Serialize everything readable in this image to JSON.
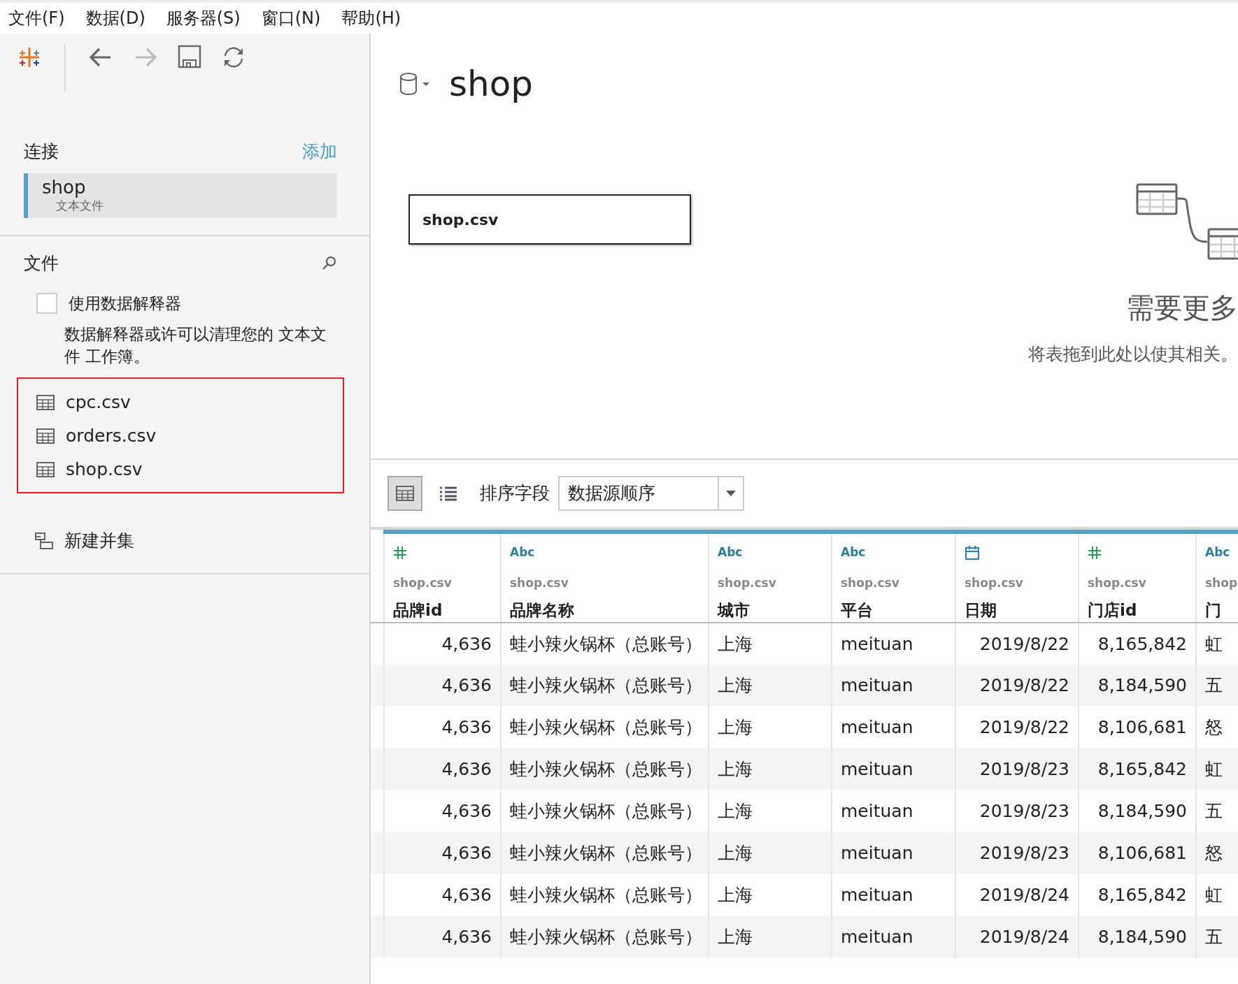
{
  "menu": [
    "文件(F)",
    "数据(D)",
    "服务器(S)",
    "窗口(N)",
    "帮助(H)"
  ],
  "toolbar": [
    {
      "kind": "logo",
      "disabled": false
    },
    {
      "kind": "back",
      "disabled": false
    },
    {
      "kind": "forward",
      "disabled": true
    },
    {
      "kind": "save",
      "disabled": false
    },
    {
      "kind": "refresh",
      "disabled": false
    }
  ],
  "connections": {
    "title": "连接",
    "add_link": "添加",
    "items": [
      {
        "name": "shop",
        "type": "文本文件",
        "selected": true
      }
    ]
  },
  "files": {
    "title": "文件",
    "interpreter": {
      "label": "使用数据解释器",
      "checked": false,
      "description": "数据解释器或许可以清理您的 文本文件 工作簿。"
    },
    "tables": [
      "cpc.csv",
      "orders.csv",
      "shop.csv"
    ],
    "new_union": "新建并集"
  },
  "datasource": {
    "title": "shop",
    "canvas_table": "shop.csv",
    "hint_title": "需要更多",
    "hint_text": "将表拖到此处以使其相关。"
  },
  "grid_toolbar": {
    "views": [
      {
        "kind": "grid",
        "selected": true
      },
      {
        "kind": "list",
        "selected": false
      }
    ],
    "sort_label": "排序字段",
    "sort_value": "数据源顺序"
  },
  "table": {
    "columns": [
      {
        "kind": "number",
        "source": "shop.csv",
        "name": "品牌id"
      },
      {
        "kind": "string",
        "type_label": "Abc",
        "source": "shop.csv",
        "name": "品牌名称"
      },
      {
        "kind": "string",
        "type_label": "Abc",
        "source": "shop.csv",
        "name": "城市"
      },
      {
        "kind": "string",
        "type_label": "Abc",
        "source": "shop.csv",
        "name": "平台"
      },
      {
        "kind": "date",
        "source": "shop.csv",
        "name": "日期"
      },
      {
        "kind": "number",
        "source": "shop.csv",
        "name": "门店id"
      },
      {
        "kind": "string",
        "type_label": "Abc",
        "source": "shop",
        "name": "门"
      }
    ],
    "rows": [
      [
        "4,636",
        "蛙小辣火锅杯（总账号）",
        "上海",
        "meituan",
        "2019/8/22",
        "8,165,842",
        "虹"
      ],
      [
        "4,636",
        "蛙小辣火锅杯（总账号）",
        "上海",
        "meituan",
        "2019/8/22",
        "8,184,590",
        "五"
      ],
      [
        "4,636",
        "蛙小辣火锅杯（总账号）",
        "上海",
        "meituan",
        "2019/8/22",
        "8,106,681",
        "怒"
      ],
      [
        "4,636",
        "蛙小辣火锅杯（总账号）",
        "上海",
        "meituan",
        "2019/8/23",
        "8,165,842",
        "虹"
      ],
      [
        "4,636",
        "蛙小辣火锅杯（总账号）",
        "上海",
        "meituan",
        "2019/8/23",
        "8,184,590",
        "五"
      ],
      [
        "4,636",
        "蛙小辣火锅杯（总账号）",
        "上海",
        "meituan",
        "2019/8/23",
        "8,106,681",
        "怒"
      ],
      [
        "4,636",
        "蛙小辣火锅杯（总账号）",
        "上海",
        "meituan",
        "2019/8/24",
        "8,165,842",
        "虹"
      ],
      [
        "4,636",
        "蛙小辣火锅杯（总账号）",
        "上海",
        "meituan",
        "2019/8/24",
        "8,184,590",
        "五"
      ]
    ]
  }
}
